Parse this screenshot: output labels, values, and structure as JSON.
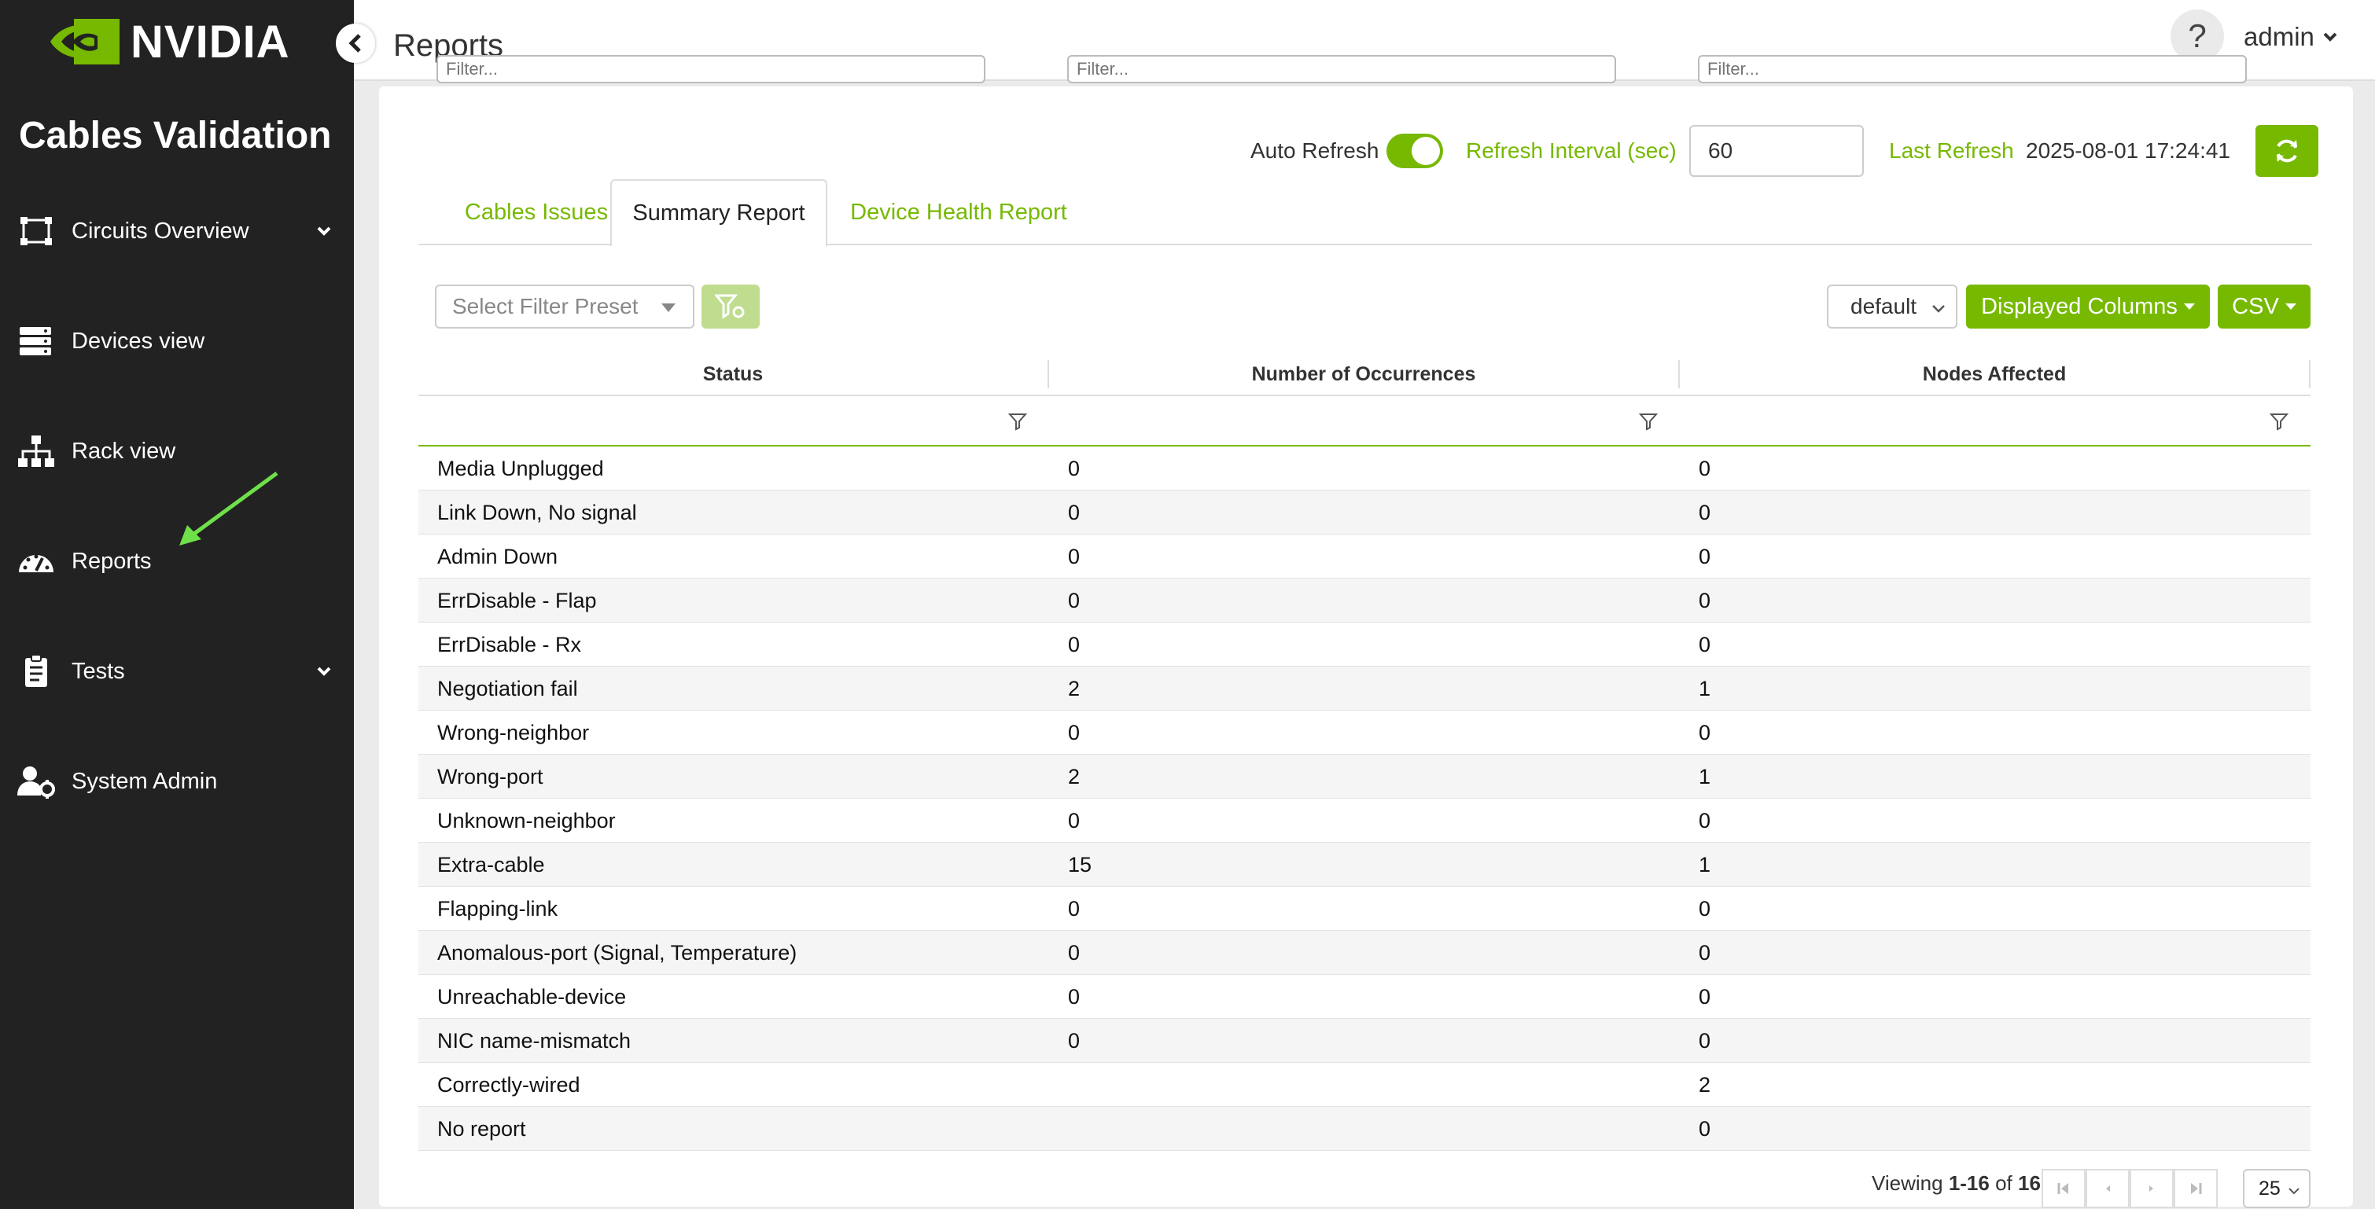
{
  "brand": {
    "logo_text": "NVIDIA",
    "app_title": "Cables Validation",
    "accent": "#76b900"
  },
  "sidebar": {
    "items": [
      {
        "label": "Circuits Overview",
        "icon": "circuit-icon",
        "expandable": true
      },
      {
        "label": "Devices view",
        "icon": "server-icon",
        "expandable": false
      },
      {
        "label": "Rack view",
        "icon": "hierarchy-icon",
        "expandable": false
      },
      {
        "label": "Reports",
        "icon": "gauge-icon",
        "expandable": false
      },
      {
        "label": "Tests",
        "icon": "clipboard-icon",
        "expandable": true
      },
      {
        "label": "System Admin",
        "icon": "user-gear-icon",
        "expandable": false
      }
    ]
  },
  "header": {
    "title": "Reports",
    "help": "?",
    "user": "admin"
  },
  "toolbar": {
    "auto_refresh_label": "Auto Refresh",
    "auto_refresh_on": true,
    "interval_label": "Refresh Interval (sec)",
    "interval_value": "60",
    "last_refresh_label": "Last Refresh",
    "last_refresh_value": "2025-08-01 17:24:41"
  },
  "tabs": [
    {
      "label": "Cables Issues",
      "active": false
    },
    {
      "label": "Summary Report",
      "active": true
    },
    {
      "label": "Device Health Report",
      "active": false
    }
  ],
  "filters": {
    "preset_placeholder": "Select Filter Preset",
    "view_select": "default",
    "displayed_columns": "Displayed Columns",
    "csv": "CSV",
    "filter_placeholder": "Filter..."
  },
  "table": {
    "columns": [
      "Status",
      "Number of Occurrences",
      "Nodes Affected"
    ],
    "rows": [
      [
        "Media Unplugged",
        "0",
        "0"
      ],
      [
        "Link Down, No signal",
        "0",
        "0"
      ],
      [
        "Admin Down",
        "0",
        "0"
      ],
      [
        "ErrDisable - Flap",
        "0",
        "0"
      ],
      [
        "ErrDisable - Rx",
        "0",
        "0"
      ],
      [
        "Negotiation fail",
        "2",
        "1"
      ],
      [
        "Wrong-neighbor",
        "0",
        "0"
      ],
      [
        "Wrong-port",
        "2",
        "1"
      ],
      [
        "Unknown-neighbor",
        "0",
        "0"
      ],
      [
        "Extra-cable",
        "15",
        "1"
      ],
      [
        "Flapping-link",
        "0",
        "0"
      ],
      [
        "Anomalous-port (Signal, Temperature)",
        "0",
        "0"
      ],
      [
        "Unreachable-device",
        "0",
        "0"
      ],
      [
        "NIC name-mismatch",
        "0",
        "0"
      ],
      [
        "Correctly-wired",
        "",
        "2"
      ],
      [
        "No report",
        "",
        "0"
      ]
    ]
  },
  "pagination": {
    "viewing_prefix": "Viewing ",
    "range": "1-16",
    "of": " of ",
    "total": "16",
    "page_size": "25"
  }
}
